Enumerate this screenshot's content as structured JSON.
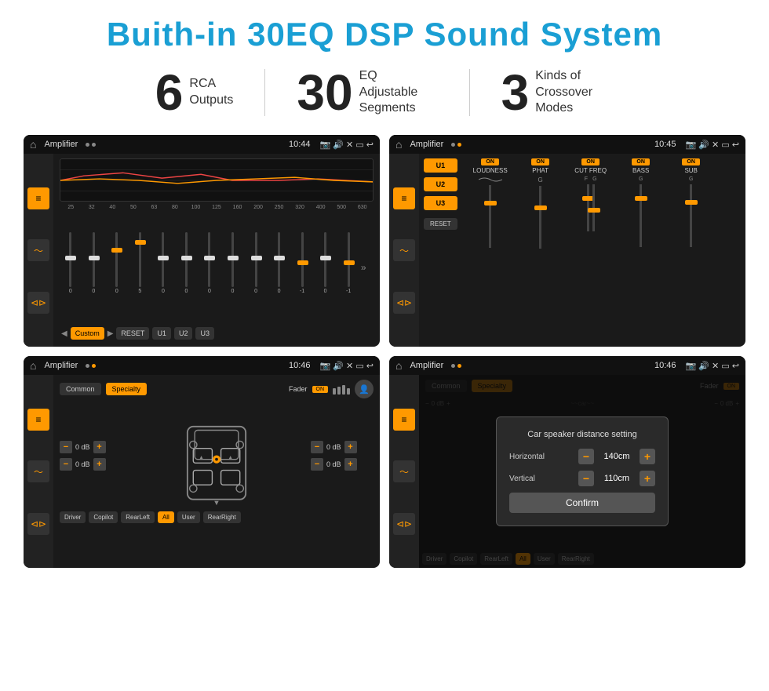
{
  "page": {
    "title": "Buith-in 30EQ DSP Sound System",
    "title_color": "#1a9fd4"
  },
  "stats": [
    {
      "number": "6",
      "line1": "RCA",
      "line2": "Outputs"
    },
    {
      "number": "30",
      "line1": "EQ Adjustable",
      "line2": "Segments"
    },
    {
      "number": "3",
      "line1": "Kinds of",
      "line2": "Crossover Modes"
    }
  ],
  "screens": [
    {
      "id": "screen1",
      "status": {
        "title": "Amplifier",
        "time": "10:44"
      },
      "type": "eq"
    },
    {
      "id": "screen2",
      "status": {
        "title": "Amplifier",
        "time": "10:45"
      },
      "type": "amp"
    },
    {
      "id": "screen3",
      "status": {
        "title": "Amplifier",
        "time": "10:46"
      },
      "type": "speaker"
    },
    {
      "id": "screen4",
      "status": {
        "title": "Amplifier",
        "time": "10:46"
      },
      "type": "dialog"
    }
  ],
  "eq": {
    "freq_labels": [
      "25",
      "32",
      "40",
      "50",
      "63",
      "80",
      "100",
      "125",
      "160",
      "200",
      "250",
      "320",
      "400",
      "500",
      "630"
    ],
    "values": [
      "0",
      "0",
      "0",
      "5",
      "0",
      "0",
      "0",
      "0",
      "0",
      "0",
      "-1",
      "0",
      "-1"
    ],
    "presets": [
      "Custom",
      "RESET",
      "U1",
      "U2",
      "U3"
    ]
  },
  "amp": {
    "u_buttons": [
      "U1",
      "U2",
      "U3"
    ],
    "channels": [
      "LOUDNESS",
      "PHAT",
      "CUT FREQ",
      "BASS",
      "SUB"
    ],
    "reset_label": "RESET"
  },
  "speaker": {
    "tabs": [
      "Common",
      "Specialty"
    ],
    "fader_label": "Fader",
    "on_label": "ON",
    "bottom_btns": [
      "Driver",
      "Copilot",
      "RearLeft",
      "All",
      "User",
      "RearRight"
    ],
    "db_values": [
      "0 dB",
      "0 dB",
      "0 dB",
      "0 dB"
    ]
  },
  "dialog": {
    "title": "Car speaker distance setting",
    "horizontal_label": "Horizontal",
    "horizontal_value": "140cm",
    "vertical_label": "Vertical",
    "vertical_value": "110cm",
    "confirm_label": "Confirm",
    "bottom_btns": [
      "Driver",
      "Copilot",
      "RearLeft",
      "All",
      "User",
      "RearRight"
    ]
  }
}
